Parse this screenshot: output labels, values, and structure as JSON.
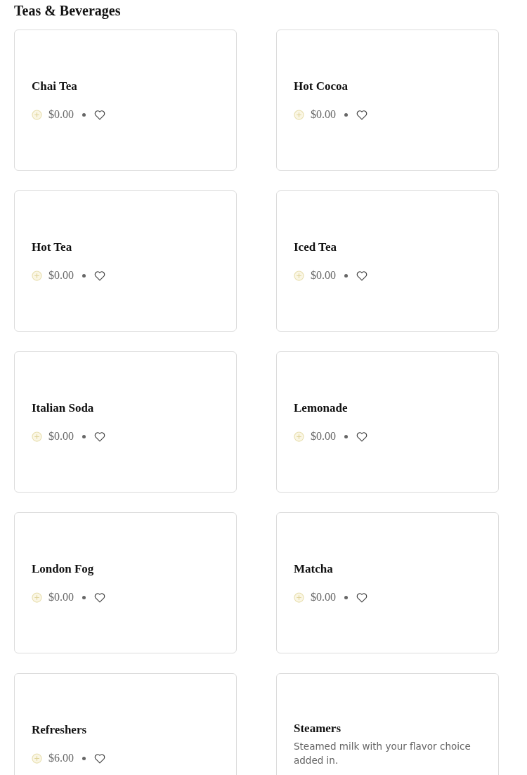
{
  "section": {
    "title": "Teas & Beverages"
  },
  "items": [
    {
      "name": "Chai Tea",
      "price": "$0.00",
      "favorite": false
    },
    {
      "name": "Hot Cocoa",
      "price": "$0.00",
      "favorite": false
    },
    {
      "name": "Hot Tea",
      "price": "$0.00",
      "favorite": false
    },
    {
      "name": "Iced Tea",
      "price": "$0.00",
      "favorite": false
    },
    {
      "name": "Italian Soda",
      "price": "$0.00",
      "favorite": false
    },
    {
      "name": "Lemonade",
      "price": "$0.00",
      "favorite": false
    },
    {
      "name": "London Fog",
      "price": "$0.00",
      "favorite": false
    },
    {
      "name": "Matcha",
      "price": "$0.00",
      "favorite": false
    },
    {
      "name": "Refreshers",
      "price": "$6.00",
      "favorite": false
    },
    {
      "name": "Steamers",
      "description": "Steamed milk with your flavor choice added in."
    }
  ]
}
